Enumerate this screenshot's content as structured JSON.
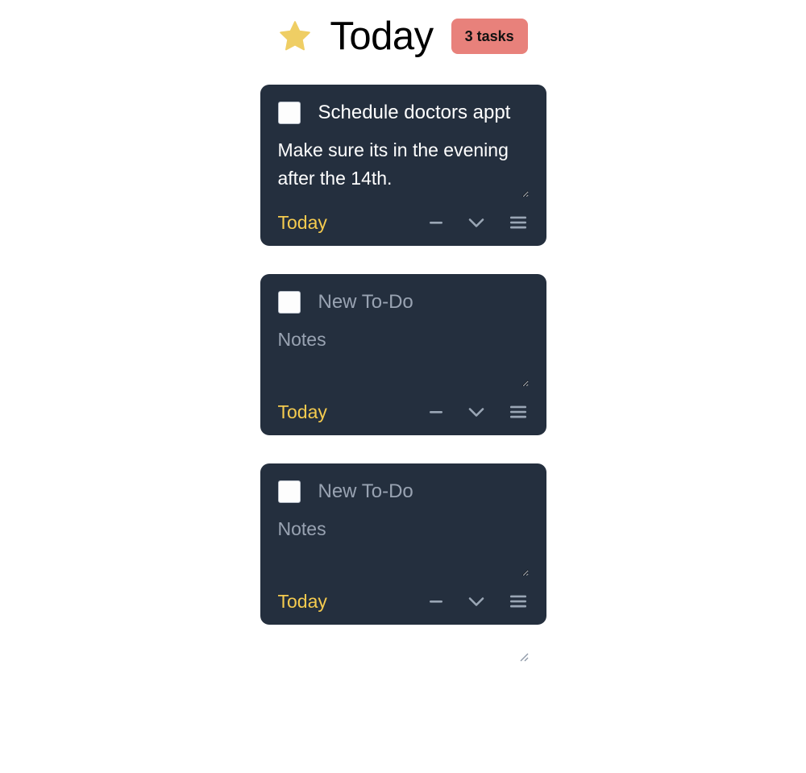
{
  "header": {
    "star_icon": "star-icon",
    "title": "Today",
    "badge_label": "3 tasks",
    "badge_color": "#e8817b",
    "title_color": "#000000"
  },
  "theme": {
    "page_background": "#ffffff",
    "card_background": "#242f3e",
    "text_primary": "#ffffff",
    "text_placeholder": "#99a3b2",
    "accent_date": "#f5cb4f",
    "icon_color": "#9aa6b5",
    "checkbox_fill": "#fdfdfd"
  },
  "tasks": [
    {
      "checked": false,
      "title": "Schedule doctors appt",
      "title_placeholder": "New To-Do",
      "title_is_placeholder": false,
      "notes": "Make sure its in the evening after the 14th.",
      "notes_placeholder": "Notes",
      "due_date": "Today",
      "actions": {
        "minus_label": "−",
        "minus_name": "minus-icon",
        "chevron_name": "chevron-down-icon",
        "menu_name": "hamburger-menu-icon"
      }
    },
    {
      "checked": false,
      "title": "",
      "title_placeholder": "New To-Do",
      "title_is_placeholder": true,
      "notes": "",
      "notes_placeholder": "Notes",
      "due_date": "Today",
      "actions": {
        "minus_label": "−",
        "minus_name": "minus-icon",
        "chevron_name": "chevron-down-icon",
        "menu_name": "hamburger-menu-icon"
      }
    },
    {
      "checked": false,
      "title": "",
      "title_placeholder": "New To-Do",
      "title_is_placeholder": true,
      "notes": "",
      "notes_placeholder": "Notes",
      "due_date": "Today",
      "actions": {
        "minus_label": "−",
        "minus_name": "minus-icon",
        "chevron_name": "chevron-down-icon",
        "menu_name": "hamburger-menu-icon"
      }
    }
  ]
}
